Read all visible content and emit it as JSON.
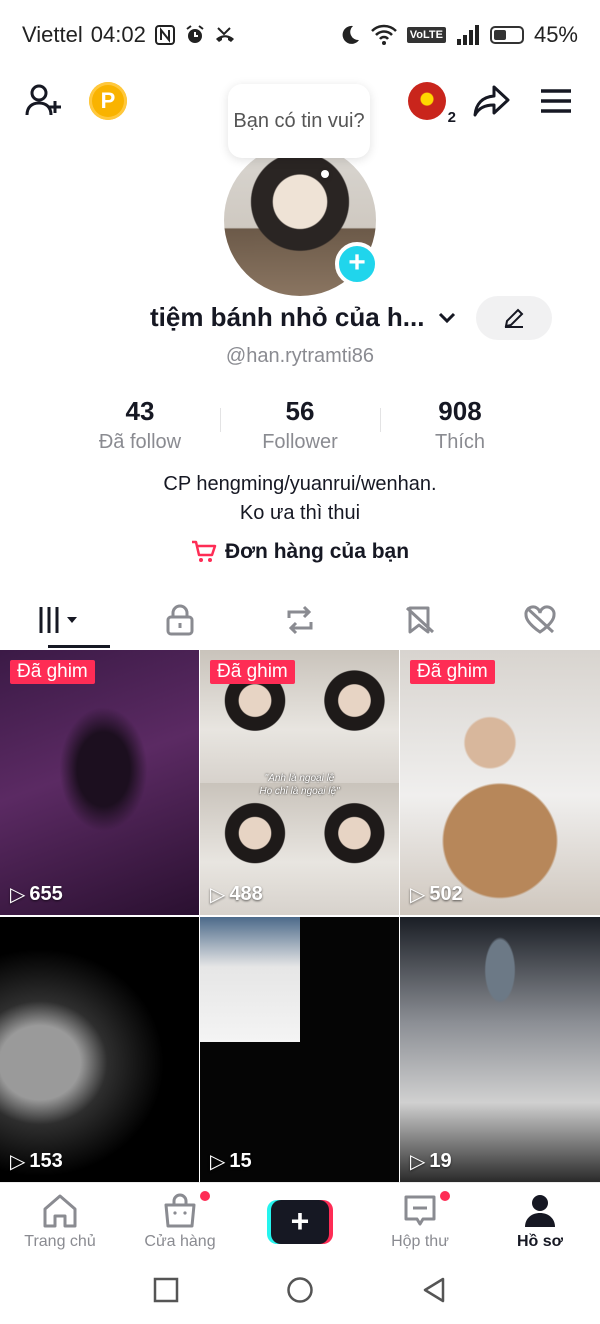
{
  "status_bar": {
    "carrier": "Viettel",
    "time": "04:02",
    "network_badge": "VoLTE",
    "battery": "45%",
    "battery_level": 0.45
  },
  "top_bar": {
    "notification_count": "2"
  },
  "profile": {
    "bubble_text": "Bạn có tin vui?",
    "display_name": "tiệm bánh nhỏ của h...",
    "username": "@han.rytramti86",
    "stats": [
      {
        "value": "43",
        "label": "Đã follow"
      },
      {
        "value": "56",
        "label": "Follower"
      },
      {
        "value": "908",
        "label": "Thích"
      }
    ],
    "bio_line1": "CP hengming/yuanrui/wenhan.",
    "bio_line2": "Ko ưa thì thui",
    "orders_label": "Đơn hàng của bạn"
  },
  "colors": {
    "accent": "#fe2c55",
    "cyan": "#25f4ee",
    "text": "#161823",
    "muted": "#8a8b91"
  },
  "videos": [
    {
      "pinned": "Đã ghim",
      "views": "655"
    },
    {
      "pinned": "Đã ghim",
      "views": "488",
      "caption_line1": "\"Anh là ngoại lệ",
      "caption_line2": "Họ chỉ là ngoại lệ\""
    },
    {
      "pinned": "Đã ghim",
      "views": "502"
    },
    {
      "views": "153"
    },
    {
      "views": "15"
    },
    {
      "views": "19"
    }
  ],
  "bottom_nav": [
    {
      "label": "Trang chủ",
      "icon": "home-icon"
    },
    {
      "label": "Cửa hàng",
      "icon": "shop-icon"
    },
    {
      "label": "",
      "icon": "create-icon"
    },
    {
      "label": "Hộp thư",
      "icon": "inbox-icon"
    },
    {
      "label": "Hồ sơ",
      "icon": "profile-icon"
    }
  ]
}
